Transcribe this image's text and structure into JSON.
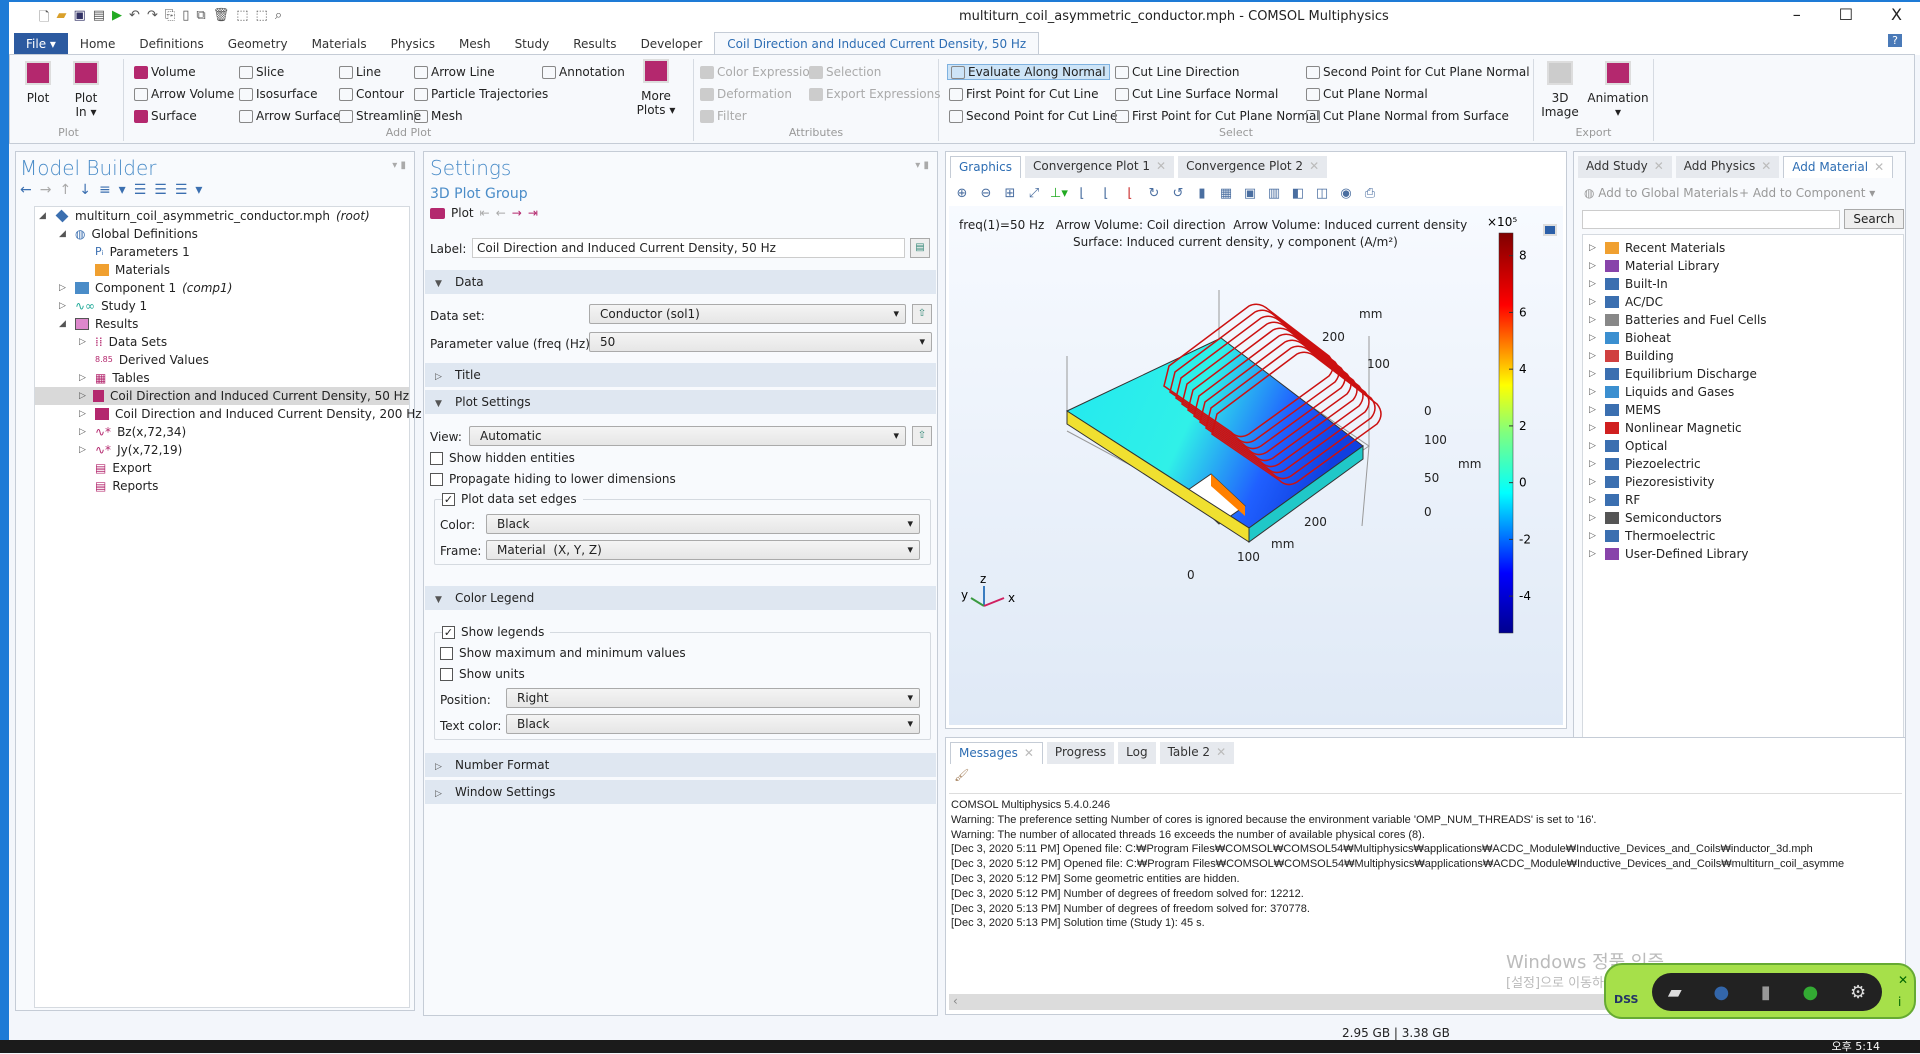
{
  "window": {
    "title": "multiturn_coil_asymmetric_conductor.mph - COMSOL Multiphysics",
    "minimize": "–",
    "maximize": "☐",
    "close": "X"
  },
  "ribbon_tabs": [
    "File ▾",
    "Home",
    "Definitions",
    "Geometry",
    "Materials",
    "Physics",
    "Mesh",
    "Study",
    "Results",
    "Developer",
    "Coil Direction and Induced Current Density, 50 Hz"
  ],
  "help": "?",
  "ribbon": {
    "plot": {
      "plot": "Plot",
      "plot_in": "Plot\nIn ▾",
      "label": "Plot"
    },
    "add_plot": {
      "items": [
        "Volume",
        "Arrow Volume",
        "Surface",
        "Slice",
        "Isosurface",
        "Arrow Surface",
        "Line",
        "Contour",
        "Streamline",
        "Arrow Line",
        "Particle Trajectories",
        "Mesh",
        "Annotation"
      ],
      "more": "More\nPlots ▾",
      "label": "Add Plot"
    },
    "attributes": {
      "items": [
        "Color Expression",
        "Deformation",
        "Filter",
        "Selection",
        "Export Expressions"
      ],
      "label": "Attributes"
    },
    "select": {
      "items": [
        "Evaluate Along Normal",
        "First Point for Cut Line",
        "Second Point for Cut Line",
        "Cut Line Direction",
        "Cut Line Surface Normal",
        "First Point for Cut Plane Normal",
        "Second Point for Cut Plane Normal",
        "Cut Plane Normal",
        "Cut Plane Normal from Surface"
      ],
      "label": "Select"
    },
    "export": {
      "image": "3D\nImage",
      "animation": "Animation\n▾",
      "label": "Export"
    }
  },
  "model_builder": {
    "title": "Model Builder",
    "tree": [
      {
        "label": "multiturn_coil_asymmetric_conductor.mph",
        "tag": "(root)"
      },
      {
        "label": "Global Definitions"
      },
      {
        "label": "Parameters 1"
      },
      {
        "label": "Materials"
      },
      {
        "label": "Component 1",
        "tag": "(comp1)"
      },
      {
        "label": "Study 1"
      },
      {
        "label": "Results"
      },
      {
        "label": "Data Sets"
      },
      {
        "label": "Derived Values"
      },
      {
        "label": "Tables"
      },
      {
        "label": "Coil Direction and Induced Current Density, 50 Hz"
      },
      {
        "label": "Coil Direction and Induced Current Density, 200 Hz"
      },
      {
        "label": "Bz(x,72,34)"
      },
      {
        "label": "Jy(x,72,19)"
      },
      {
        "label": "Export"
      },
      {
        "label": "Reports"
      }
    ]
  },
  "settings": {
    "title": "Settings",
    "subtitle": "3D Plot Group",
    "plot": "Plot",
    "label_label": "Label:",
    "label_value": "Coil Direction and Induced Current Density, 50 Hz",
    "sections": {
      "data": "Data",
      "title": "Title",
      "plot_settings": "Plot Settings",
      "color_legend": "Color Legend",
      "number_format": "Number Format",
      "window_settings": "Window Settings"
    },
    "data_set_label": "Data set:",
    "data_set": "Conductor (sol1)",
    "param_label": "Parameter value (freq (Hz)):",
    "param": "50",
    "view_label": "View:",
    "view": "Automatic",
    "show_hidden": "Show hidden entities",
    "propagate": "Propagate hiding to lower dimensions",
    "plot_edges": "Plot data set edges",
    "color_label": "Color:",
    "color": "Black",
    "frame_label": "Frame:",
    "frame": "Material  (X, Y, Z)",
    "show_legends": "Show legends",
    "show_maxmin": "Show maximum and minimum values",
    "show_units": "Show units",
    "position_label": "Position:",
    "position": "Right",
    "textcolor_label": "Text color:",
    "textcolor": "Black",
    "check": "✓"
  },
  "graphics": {
    "tabs": [
      "Graphics",
      "Convergence Plot 1",
      "Convergence Plot 2"
    ],
    "title_line1": "freq(1)=50 Hz   Arrow Volume: Coil direction  Arrow Volume: Induced current density",
    "title_line2": "Surface: Induced current density, y component (A/m²)",
    "colorbar": {
      "multiplier": "×10⁵",
      "ticks": [
        "8",
        "6",
        "4",
        "2",
        "0",
        "-2",
        "-4"
      ],
      "min": -5.3,
      "max": 8.8
    },
    "axis_labels": {
      "x_ticks": [
        "0",
        "100",
        "200"
      ],
      "y_ticks": [
        "0",
        "100",
        "200"
      ],
      "z_ticks": [
        "0",
        "50",
        "100"
      ],
      "unit": "mm"
    },
    "triad": {
      "x": "x",
      "y": "y",
      "z": "z"
    }
  },
  "add_panel": {
    "tabs": [
      "Add Study",
      "Add Physics",
      "Add Material"
    ],
    "add_global": "Add to Global Materials",
    "add_component": "Add to Component ▾",
    "search": "Search",
    "items": [
      "Recent Materials",
      "Material Library",
      "Built-In",
      "AC/DC",
      "Batteries and Fuel Cells",
      "Bioheat",
      "Building",
      "Equilibrium Discharge",
      "Liquids and Gases",
      "MEMS",
      "Nonlinear Magnetic",
      "Optical",
      "Piezoelectric",
      "Piezoresistivity",
      "RF",
      "Semiconductors",
      "Thermoelectric",
      "User-Defined Library"
    ]
  },
  "messages": {
    "tabs": [
      "Messages",
      "Progress",
      "Log",
      "Table 2"
    ],
    "lines": [
      "COMSOL Multiphysics 5.4.0.246",
      "Warning: The preference setting Number of cores is ignored because the environment variable 'OMP_NUM_THREADS' is set to '16'.",
      "Warning: The number of allocated threads 16 exceeds the number of available physical cores (8).",
      "[Dec 3, 2020 5:11 PM] Opened file: C:₩Program Files₩COMSOL₩COMSOL54₩Multiphysics₩applications₩ACDC_Module₩Inductive_Devices_and_Coils₩inductor_3d.mph",
      "[Dec 3, 2020 5:12 PM] Opened file: C:₩Program Files₩COMSOL₩COMSOL54₩Multiphysics₩applications₩ACDC_Module₩Inductive_Devices_and_Coils₩multiturn_coil_asymme",
      "[Dec 3, 2020 5:12 PM] Some geometric entities are hidden.",
      "[Dec 3, 2020 5:12 PM] Number of degrees of freedom solved for: 12212.",
      "[Dec 3, 2020 5:13 PM] Number of degrees of freedom solved for: 370778.",
      "[Dec 3, 2020 5:13 PM] Solution time (Study 1): 45 s."
    ]
  },
  "watermark": {
    "line1": "Windows 정품 인증",
    "line2": "[설정]으로 이동하여 Windows를 정품 인증합니다."
  },
  "dss": {
    "label": "DSS"
  },
  "status": {
    "memory": "2.95 GB | 3.38 GB"
  },
  "taskbar": {
    "time": "오후 5:14"
  }
}
